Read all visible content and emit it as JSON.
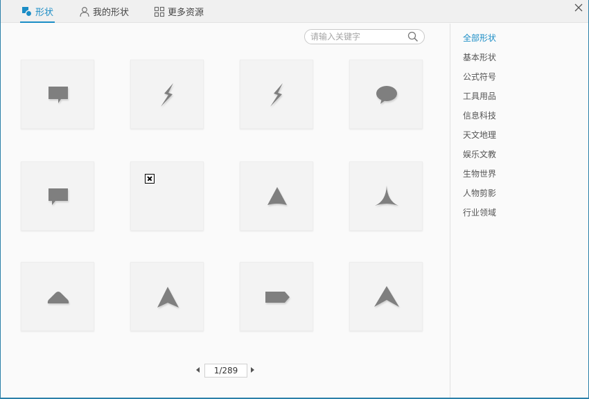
{
  "tabs": [
    {
      "label": "形状",
      "icon": "shape-icon",
      "active": true
    },
    {
      "label": "我的形状",
      "icon": "user-icon",
      "active": false
    },
    {
      "label": "更多资源",
      "icon": "grid-icon",
      "active": false
    }
  ],
  "search": {
    "placeholder": "请输入关键字",
    "value": ""
  },
  "shapes": [
    {
      "icon": "speech-bubble-rectangle-icon"
    },
    {
      "icon": "lightning-bolt-icon"
    },
    {
      "icon": "lightning-bolt-icon"
    },
    {
      "icon": "speech-bubble-oval-icon"
    },
    {
      "icon": "speech-bubble-rectangle-icon"
    },
    {
      "icon": "broken-image-icon"
    },
    {
      "icon": "triangle-curved-icon"
    },
    {
      "icon": "triangle-concave-icon"
    },
    {
      "icon": "rounded-mound-icon"
    },
    {
      "icon": "arrowhead-icon"
    },
    {
      "icon": "pentagon-tag-icon"
    },
    {
      "icon": "chevron-arrowhead-icon"
    }
  ],
  "pager": {
    "current": "1/289"
  },
  "categories": [
    {
      "label": "全部形状",
      "active": true
    },
    {
      "label": "基本形状",
      "active": false
    },
    {
      "label": "公式符号",
      "active": false
    },
    {
      "label": "工具用品",
      "active": false
    },
    {
      "label": "信息科技",
      "active": false
    },
    {
      "label": "天文地理",
      "active": false
    },
    {
      "label": "娱乐文教",
      "active": false
    },
    {
      "label": "生物世界",
      "active": false
    },
    {
      "label": "人物剪影",
      "active": false
    },
    {
      "label": "行业领域",
      "active": false
    }
  ],
  "colors": {
    "accent": "#1b8dc6",
    "shape_fill": "#7f7f7f",
    "window_border": "#2b7fa8"
  }
}
